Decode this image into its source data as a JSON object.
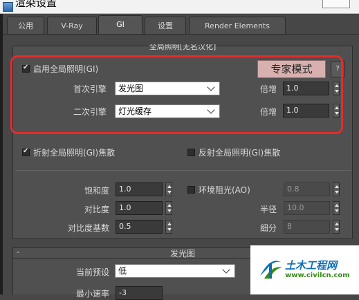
{
  "window": {
    "title": "渲染设置"
  },
  "tabs": [
    {
      "label": "公用"
    },
    {
      "label": "V-Ray"
    },
    {
      "label": "GI"
    },
    {
      "label": "设置"
    },
    {
      "label": "Render Elements"
    }
  ],
  "gi_rollout": {
    "title": "全局照明[无名汉化]",
    "enable_gi": {
      "label": "启用全局照明(GI)",
      "checked": true
    },
    "expert_mode": "专家模式",
    "help": "?",
    "primary": {
      "label": "首次引擎",
      "value": "发光图",
      "mult_label": "倍增",
      "mult": "1.0"
    },
    "secondary": {
      "label": "二次引擎",
      "value": "灯光缓存",
      "mult_label": "倍增",
      "mult": "1.0"
    },
    "refractive_caustics": {
      "label": "折射全局照明(GI)焦散",
      "checked": true
    },
    "reflective_caustics": {
      "label": "反射全局照明(GI)焦散",
      "checked": false
    },
    "saturation": {
      "label": "饱和度",
      "value": "1.0"
    },
    "contrast": {
      "label": "对比度",
      "value": "1.0"
    },
    "contrast_base": {
      "label": "对比度基数",
      "value": "0.5"
    },
    "ao": {
      "label": "环境阻光(AO)",
      "checked": false,
      "value": "0.8"
    },
    "radius": {
      "label": "半径",
      "value": "10.0"
    },
    "subdivs": {
      "label": "细分",
      "value": "8"
    }
  },
  "irradiance_rollout": {
    "collapse": "-",
    "title": "发光图",
    "preset": {
      "label": "当前预设",
      "value": "低"
    },
    "min_rate": {
      "label": "最小速率",
      "value": "-3"
    }
  },
  "watermark": {
    "cn": "土木工程网",
    "url": "www.civilcn.com"
  },
  "colors": {
    "highlight_box": "#e62b2b",
    "expert_button": "#d8b0b0",
    "panel": "#505050",
    "watermark_blue": "#0d6fb8",
    "watermark_green": "#3a8a1e"
  }
}
